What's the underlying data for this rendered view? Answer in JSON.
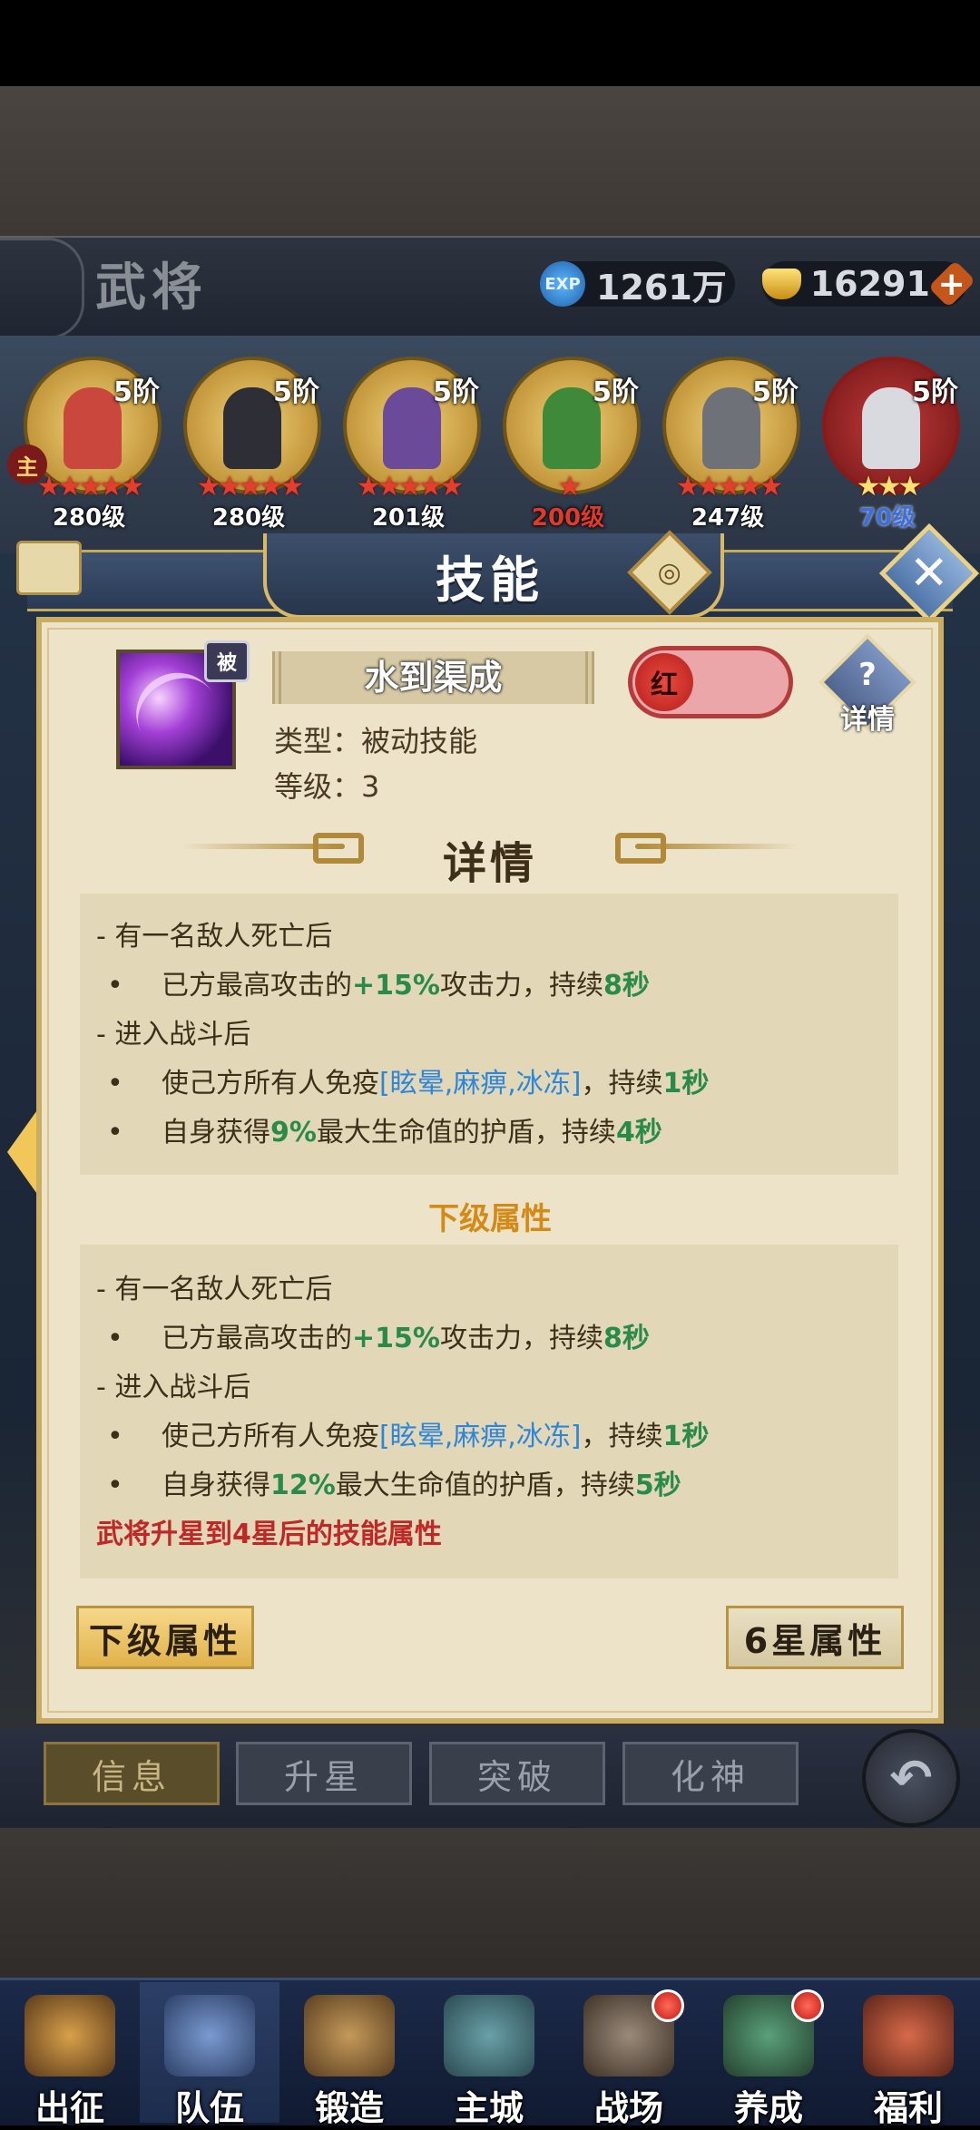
{
  "header": {
    "title": "武将",
    "exp_value": "1261万",
    "gold_value": "16291",
    "exp_icon": "EXP",
    "plus": "+"
  },
  "heroes": [
    {
      "tier": "5阶",
      "stars": "★★★★★",
      "level": "280级"
    },
    {
      "tier": "5阶",
      "stars": "★★★★★",
      "level": "280级"
    },
    {
      "tier": "5阶",
      "stars": "★★★★★",
      "level": "201级"
    },
    {
      "tier": "5阶",
      "stars": "★",
      "level": "200级"
    },
    {
      "tier": "5阶",
      "stars": "★★★★★",
      "level": "247级"
    },
    {
      "tier": "5阶",
      "stars": "★★★",
      "level": "70级"
    }
  ],
  "main_tag": "主",
  "panel": {
    "title": "技能",
    "skill_name": "水到渠成",
    "passive_badge": "被",
    "type_line": "类型：被动技能",
    "level_line": "等级：3",
    "grade": "红",
    "detail_q": "?",
    "detail_label": "详情",
    "section_title": "详情",
    "current": {
      "h1": "- 有一名敌人死亡后",
      "l1_a": "已方最高攻击的",
      "l1_b": "+15%",
      "l1_c": "攻击力，持续",
      "l1_d": "8秒",
      "h2": "- 进入战斗后",
      "l2_a": "使己方所有人免疫",
      "l2_b": "[眩晕,麻痹,冰冻]",
      "l2_c": "，持续",
      "l2_d": "1秒",
      "l3_a": "自身获得",
      "l3_b": "9%",
      "l3_c": "最大生命值的护盾，持续",
      "l3_d": "4秒"
    },
    "next_title": "下级属性",
    "next": {
      "h1": "- 有一名敌人死亡后",
      "l1_a": "已方最高攻击的",
      "l1_b": "+15%",
      "l1_c": "攻击力，持续",
      "l1_d": "8秒",
      "h2": "- 进入战斗后",
      "l2_a": "使己方所有人免疫",
      "l2_b": "[眩晕,麻痹,冰冻]",
      "l2_c": "，持续",
      "l2_d": "1秒",
      "l3_a": "自身获得",
      "l3_b": "12%",
      "l3_c": "最大生命值的护盾，持续",
      "l3_d": "5秒",
      "note": "武将升星到4星后的技能属性"
    },
    "prev_button": "下级属性",
    "six_star_button": "6星属性"
  },
  "tabs": [
    "信息",
    "升星",
    "突破",
    "化神"
  ],
  "bottom_nav": [
    "出征",
    "队伍",
    "锻造",
    "主城",
    "战场",
    "养成",
    "福利"
  ],
  "colors": {
    "green": "#2a8a4a",
    "blue": "#2d86d9",
    "red": "#c02828",
    "gold": "#d38a16"
  }
}
